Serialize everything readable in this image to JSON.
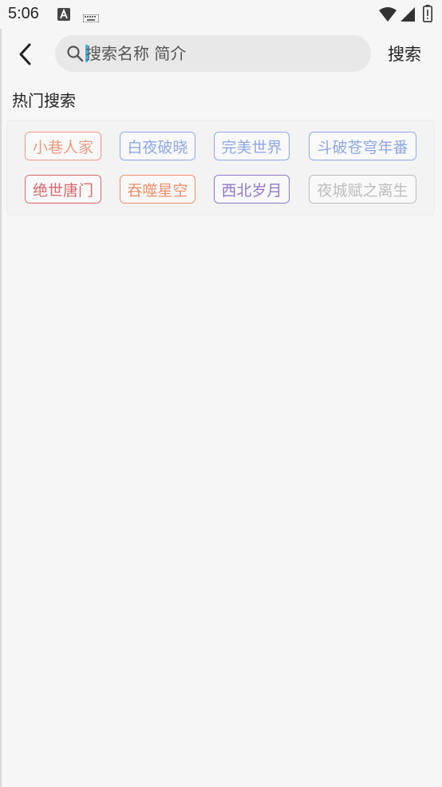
{
  "status_bar": {
    "time": "5:06",
    "icons": [
      "a-notification-icon",
      "keyboard-icon",
      "wifi-icon",
      "cell-signal-icon",
      "battery-icon"
    ]
  },
  "header": {
    "back_icon": "chevron-left-icon",
    "search": {
      "placeholder": "搜索名称 简介",
      "value": ""
    },
    "search_button_label": "搜索"
  },
  "hot_search": {
    "title": "热门搜索",
    "tags": [
      {
        "label": "小巷人家",
        "color": "#ef9a7c"
      },
      {
        "label": "白夜破晓",
        "color": "#8ea7e6"
      },
      {
        "label": "完美世界",
        "color": "#8ea7e6"
      },
      {
        "label": "斗破苍穹年番",
        "color": "#8ea7e6"
      },
      {
        "label": "绝世唐门",
        "color": "#d9686a"
      },
      {
        "label": "吞噬星空",
        "color": "#ee8d67"
      },
      {
        "label": "西北岁月",
        "color": "#8f77c9"
      },
      {
        "label": "夜城赋之离生",
        "color": "#bdbdbd"
      }
    ]
  },
  "colors": {
    "background": "#f6f6f7",
    "search_box": "#e8e8e9",
    "caret": "#3fb6e8"
  }
}
